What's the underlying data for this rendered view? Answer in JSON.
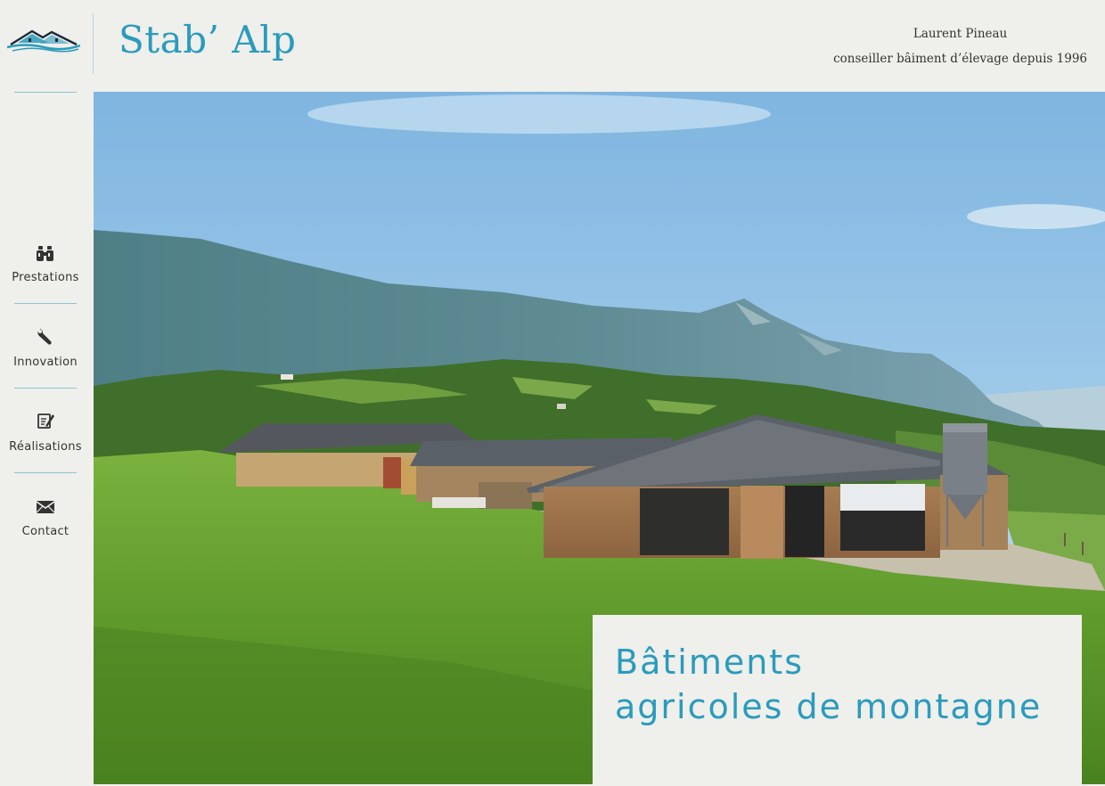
{
  "header": {
    "brand": "Stab’ Alp",
    "owner_name": "Laurent Pineau",
    "owner_role": "conseiller bâiment d’élevage depuis 1996",
    "logo_icon": "house-roof-wave-icon"
  },
  "sidebar": {
    "items": [
      {
        "label": "Prestations",
        "icon": "binoculars-icon"
      },
      {
        "label": "Innovation",
        "icon": "wrench-icon"
      },
      {
        "label": "Réalisations",
        "icon": "edit-document-icon"
      },
      {
        "label": "Contact",
        "icon": "envelope-icon"
      }
    ]
  },
  "hero": {
    "title_line1": "Bâtiments",
    "title_line2": "agricoles de montagne"
  },
  "colors": {
    "accent": "#2a9bbd",
    "background": "#efefeb",
    "text": "#333333",
    "divider": "#8fc3d2"
  }
}
